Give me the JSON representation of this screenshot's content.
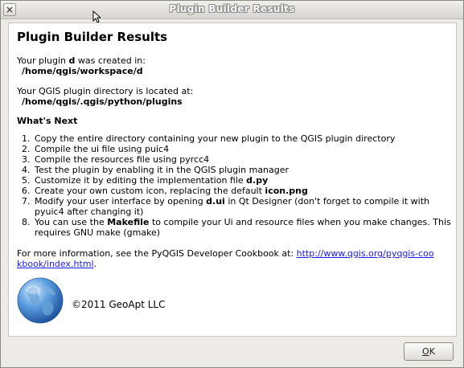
{
  "window": {
    "title": "Plugin Builder Results",
    "close_glyph": "×"
  },
  "content": {
    "heading": "Plugin Builder Results",
    "created_prefix": "Your plugin ",
    "plugin_name": "d",
    "created_suffix": " was created in:",
    "created_path": "/home/qgis/workspace/d",
    "plugin_dir_label": "Your QGIS plugin directory is located at:",
    "plugin_dir_path": "/home/qgis/.qgis/python/plugins",
    "whats_next": "What's Next",
    "steps": [
      {
        "text": "Copy the entire directory containing your new plugin to the QGIS plugin directory"
      },
      {
        "text": "Compile the ui file using puic4"
      },
      {
        "text": "Compile the resources file using pyrcc4"
      },
      {
        "text": "Test the plugin by enabling it in the QGIS plugin manager"
      },
      {
        "text": "Customize it by editing the implementation file ",
        "bold": "d.py",
        "after": ""
      },
      {
        "text": "Create your own custom icon, replacing the default ",
        "bold": "icon.png",
        "after": ""
      },
      {
        "text": "Modify your user interface by opening ",
        "bold": "d.ui",
        "after": " in Qt Designer (don't forget to compile it with pyuic4 after changing it)"
      },
      {
        "text": "You can use the ",
        "bold": "Makefile",
        "after": " to compile your Ui and resource files when you make changes. This requires GNU make (gmake)"
      }
    ],
    "more_info_prefix": "For more information, see the PyQGIS Developer Cookbook at: ",
    "more_info_link": "http://www.qgis.org/pyqgis-cookbook/index.html",
    "more_info_suffix": ".",
    "logo_icon": "globe-icon",
    "copyright": "©2011 GeoApt LLC"
  },
  "buttons": {
    "ok_label_underlined": "O",
    "ok_label_rest": "K"
  }
}
